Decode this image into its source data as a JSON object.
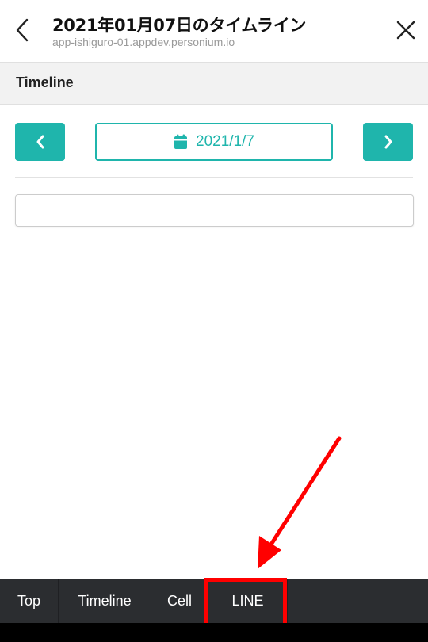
{
  "topbar": {
    "title": "2021年01月07日のタイムライン",
    "url": "app-ishiguro-01.appdev.personium.io",
    "back_icon": "chevron-left-icon",
    "close_icon": "close-icon"
  },
  "section": {
    "title": "Timeline"
  },
  "date_nav": {
    "date": "2021/1/7",
    "prev_icon": "chevron-left-icon",
    "next_icon": "chevron-right-icon",
    "calendar_icon": "calendar-icon"
  },
  "bottom_nav": {
    "tabs": [
      "Top",
      "Timeline",
      "Cell",
      "LINE"
    ]
  },
  "colors": {
    "accent": "#1fb5ac",
    "nav_bg": "#2b2d30",
    "annotation": "#ff0000"
  }
}
